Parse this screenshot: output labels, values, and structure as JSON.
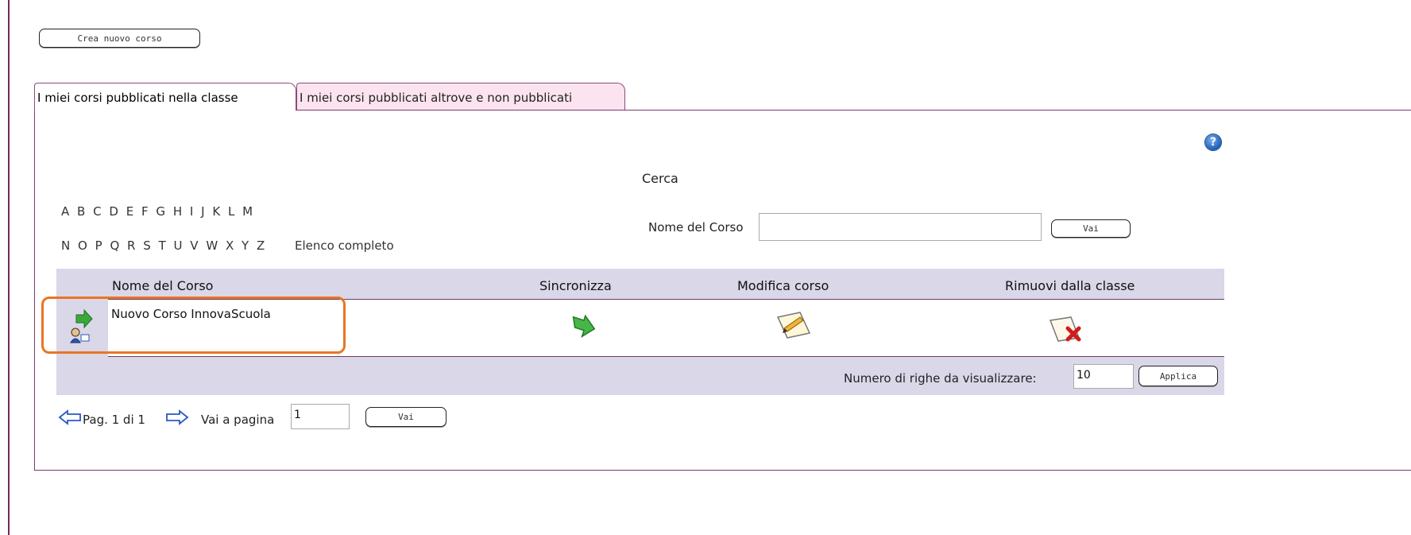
{
  "toolbar": {
    "create_course_label": "Crea nuovo corso"
  },
  "tabs": [
    {
      "label": "I miei corsi pubblicati nella classe",
      "active": true
    },
    {
      "label": "I miei corsi pubblicati altrove e non pubblicati",
      "active": false
    }
  ],
  "help_icon": {
    "glyph": "?"
  },
  "search": {
    "title": "Cerca",
    "alphabet_row1": [
      "A",
      "B",
      "C",
      "D",
      "E",
      "F",
      "G",
      "H",
      "I",
      "J",
      "K",
      "L",
      "M"
    ],
    "alphabet_row2": [
      "N",
      "O",
      "P",
      "Q",
      "R",
      "S",
      "T",
      "U",
      "V",
      "W",
      "X",
      "Y",
      "Z"
    ],
    "full_list_label": "Elenco completo",
    "course_name_label": "Nome del Corso",
    "course_name_value": "",
    "go_label": "Vai"
  },
  "table": {
    "columns": [
      "Nome del Corso",
      "Sincronizza",
      "Modifica corso",
      "Rimuovi dalla classe"
    ],
    "rows": [
      {
        "name": "Nuovo Corso InnovaScuola",
        "row_icon": "course-user-icon",
        "sync_icon": "sync-arrow-icon",
        "edit_icon": "edit-pencil-icon",
        "remove_icon": "remove-x-icon"
      }
    ],
    "rows_per_page_label": "Numero di righe da visualizzare:",
    "rows_per_page_value": "10",
    "apply_label": "Applica"
  },
  "pagination": {
    "page_text": "Pag. 1 di 1",
    "goto_label": "Vai a pagina",
    "page_value": "1",
    "go_label": "Vai"
  },
  "colors": {
    "border": "#7a3b6f",
    "inactive_tab": "#fbe4ef",
    "grid_bg": "#d9d7e8",
    "highlight": "#ea7524"
  }
}
